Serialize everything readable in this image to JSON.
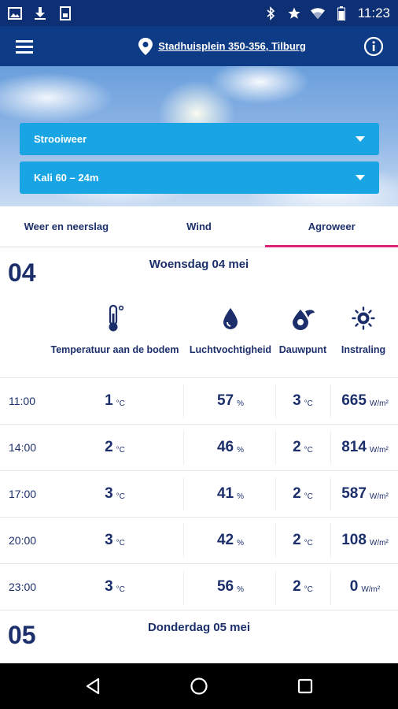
{
  "status_bar": {
    "time": "11:23",
    "left_icons": [
      "image-icon",
      "download-icon",
      "sim-icon"
    ],
    "right_icons": [
      "bluetooth-icon",
      "star-icon",
      "wifi-icon",
      "battery-icon"
    ]
  },
  "app_bar": {
    "location": "Stadhuisplein 350-356, Tilburg"
  },
  "selectors": {
    "mode": "Strooiweer",
    "product": "Kali 60 – 24m"
  },
  "tabs": [
    {
      "label": "Weer en neerslag",
      "active": false
    },
    {
      "label": "Wind",
      "active": false
    },
    {
      "label": "Agroweer",
      "active": true
    }
  ],
  "days": [
    {
      "num": "04",
      "title": "Woensdag 04 mei"
    },
    {
      "num": "05",
      "title": "Donderdag 05 mei"
    }
  ],
  "columns": [
    {
      "label": "Temperatuur aan de bodem",
      "icon": "thermometer-icon",
      "unit": "°C"
    },
    {
      "label": "Luchtvochtigheid",
      "icon": "drop-icon",
      "unit": "%"
    },
    {
      "label": "Dauwpunt",
      "icon": "dewpoint-icon",
      "unit": "°C"
    },
    {
      "label": "Instraling",
      "icon": "sun-icon",
      "unit": "W/m²"
    }
  ],
  "rows": [
    {
      "time": "11:00",
      "temp": "1",
      "humidity": "57",
      "dew": "3",
      "radiation": "665"
    },
    {
      "time": "14:00",
      "temp": "2",
      "humidity": "46",
      "dew": "2",
      "radiation": "814"
    },
    {
      "time": "17:00",
      "temp": "3",
      "humidity": "41",
      "dew": "2",
      "radiation": "587"
    },
    {
      "time": "20:00",
      "temp": "3",
      "humidity": "42",
      "dew": "2",
      "radiation": "108"
    },
    {
      "time": "23:00",
      "temp": "3",
      "humidity": "56",
      "dew": "2",
      "radiation": "0"
    }
  ],
  "colors": {
    "status_bar": "#0d2f74",
    "app_bar": "#0d3b85",
    "dropdown": "#19a4e4",
    "active_tab_indicator": "#e0237a",
    "text": "#1c2f6b"
  }
}
